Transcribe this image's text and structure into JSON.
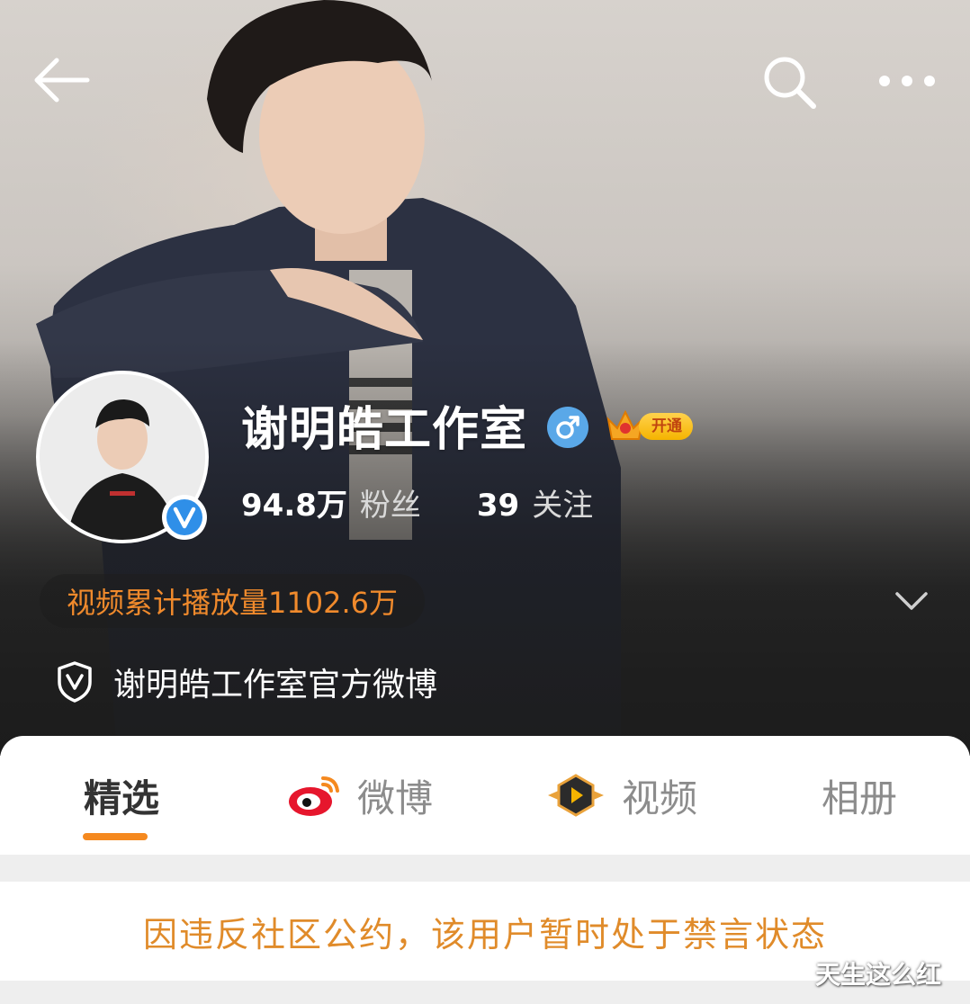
{
  "header": {
    "back_icon": "arrow-left-icon",
    "search_icon": "search-icon",
    "more_icon": "more-dots-icon"
  },
  "profile": {
    "name": "谢明皓工作室",
    "gender_icon": "male-icon",
    "vip_label": "开通",
    "verified_icon": "verified-v-icon",
    "followers_count": "94.8万",
    "followers_label": "粉丝",
    "following_count": "39",
    "following_label": "关注",
    "video_plays": "视频累计播放量1102.6万",
    "official_text": "谢明皓工作室官方微博"
  },
  "tabs": [
    {
      "label": "精选",
      "active": true
    },
    {
      "label": "微博",
      "icon": "weibo-logo-icon"
    },
    {
      "label": "视频",
      "icon": "video-play-icon"
    },
    {
      "label": "相册"
    }
  ],
  "notice": "因违反社区公约，该用户暂时处于禁言状态",
  "watermark": "天生这么红",
  "colors": {
    "accent_orange": "#f5891f",
    "notice_orange": "#e08b2a",
    "verified_blue": "#2f8fe8",
    "vip_gold": "#f5b400"
  }
}
